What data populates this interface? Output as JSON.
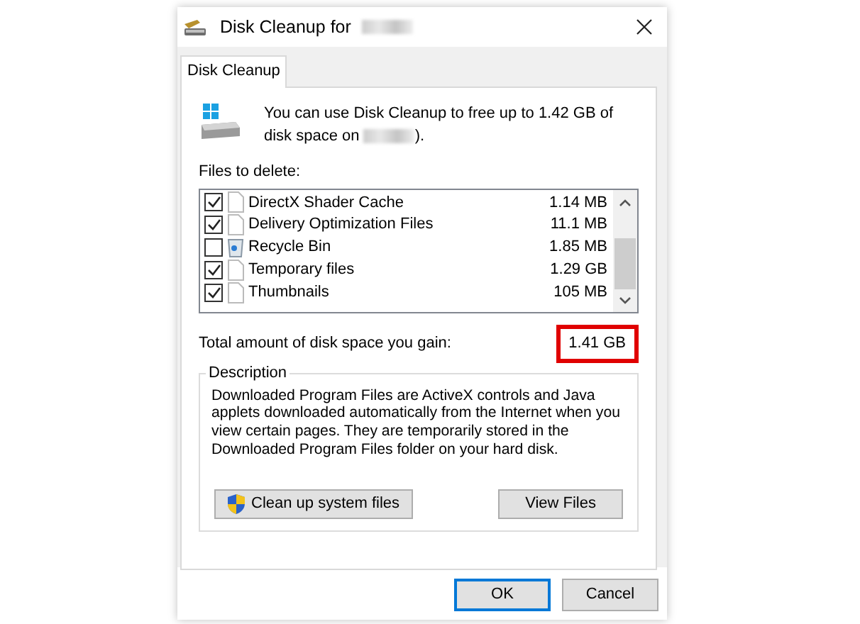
{
  "window": {
    "title": "Disk Cleanup for"
  },
  "tabs": [
    {
      "label": "Disk Cleanup",
      "selected": true
    }
  ],
  "intro": {
    "text": "You can use Disk Cleanup to free up to 1.42 GB of disk space on",
    "suffix": ")."
  },
  "files_label": "Files to delete:",
  "files": [
    {
      "name": "DirectX Shader Cache",
      "size": "1.14 MB",
      "checked": true,
      "kind": "file"
    },
    {
      "name": "Delivery Optimization Files",
      "size": "11.1 MB",
      "checked": true,
      "kind": "file"
    },
    {
      "name": "Recycle Bin",
      "size": "1.85 MB",
      "checked": false,
      "kind": "recycle"
    },
    {
      "name": "Temporary files",
      "size": "1.29 GB",
      "checked": true,
      "kind": "file"
    },
    {
      "name": "Thumbnails",
      "size": "105 MB",
      "checked": true,
      "kind": "file"
    }
  ],
  "total": {
    "label": "Total amount of disk space you gain:",
    "value": "1.41 GB",
    "highlighted": true
  },
  "description": {
    "title": "Description",
    "text": "Downloaded Program Files are ActiveX controls and Java applets downloaded automatically from the Internet when you view certain pages. They are temporarily stored in the Downloaded Program Files folder on your hard disk."
  },
  "actions": [
    "Clean up system files",
    "View Files"
  ],
  "buttons": [
    {
      "label": "OK",
      "selected": true
    },
    {
      "label": "Cancel",
      "selected": false
    }
  ]
}
